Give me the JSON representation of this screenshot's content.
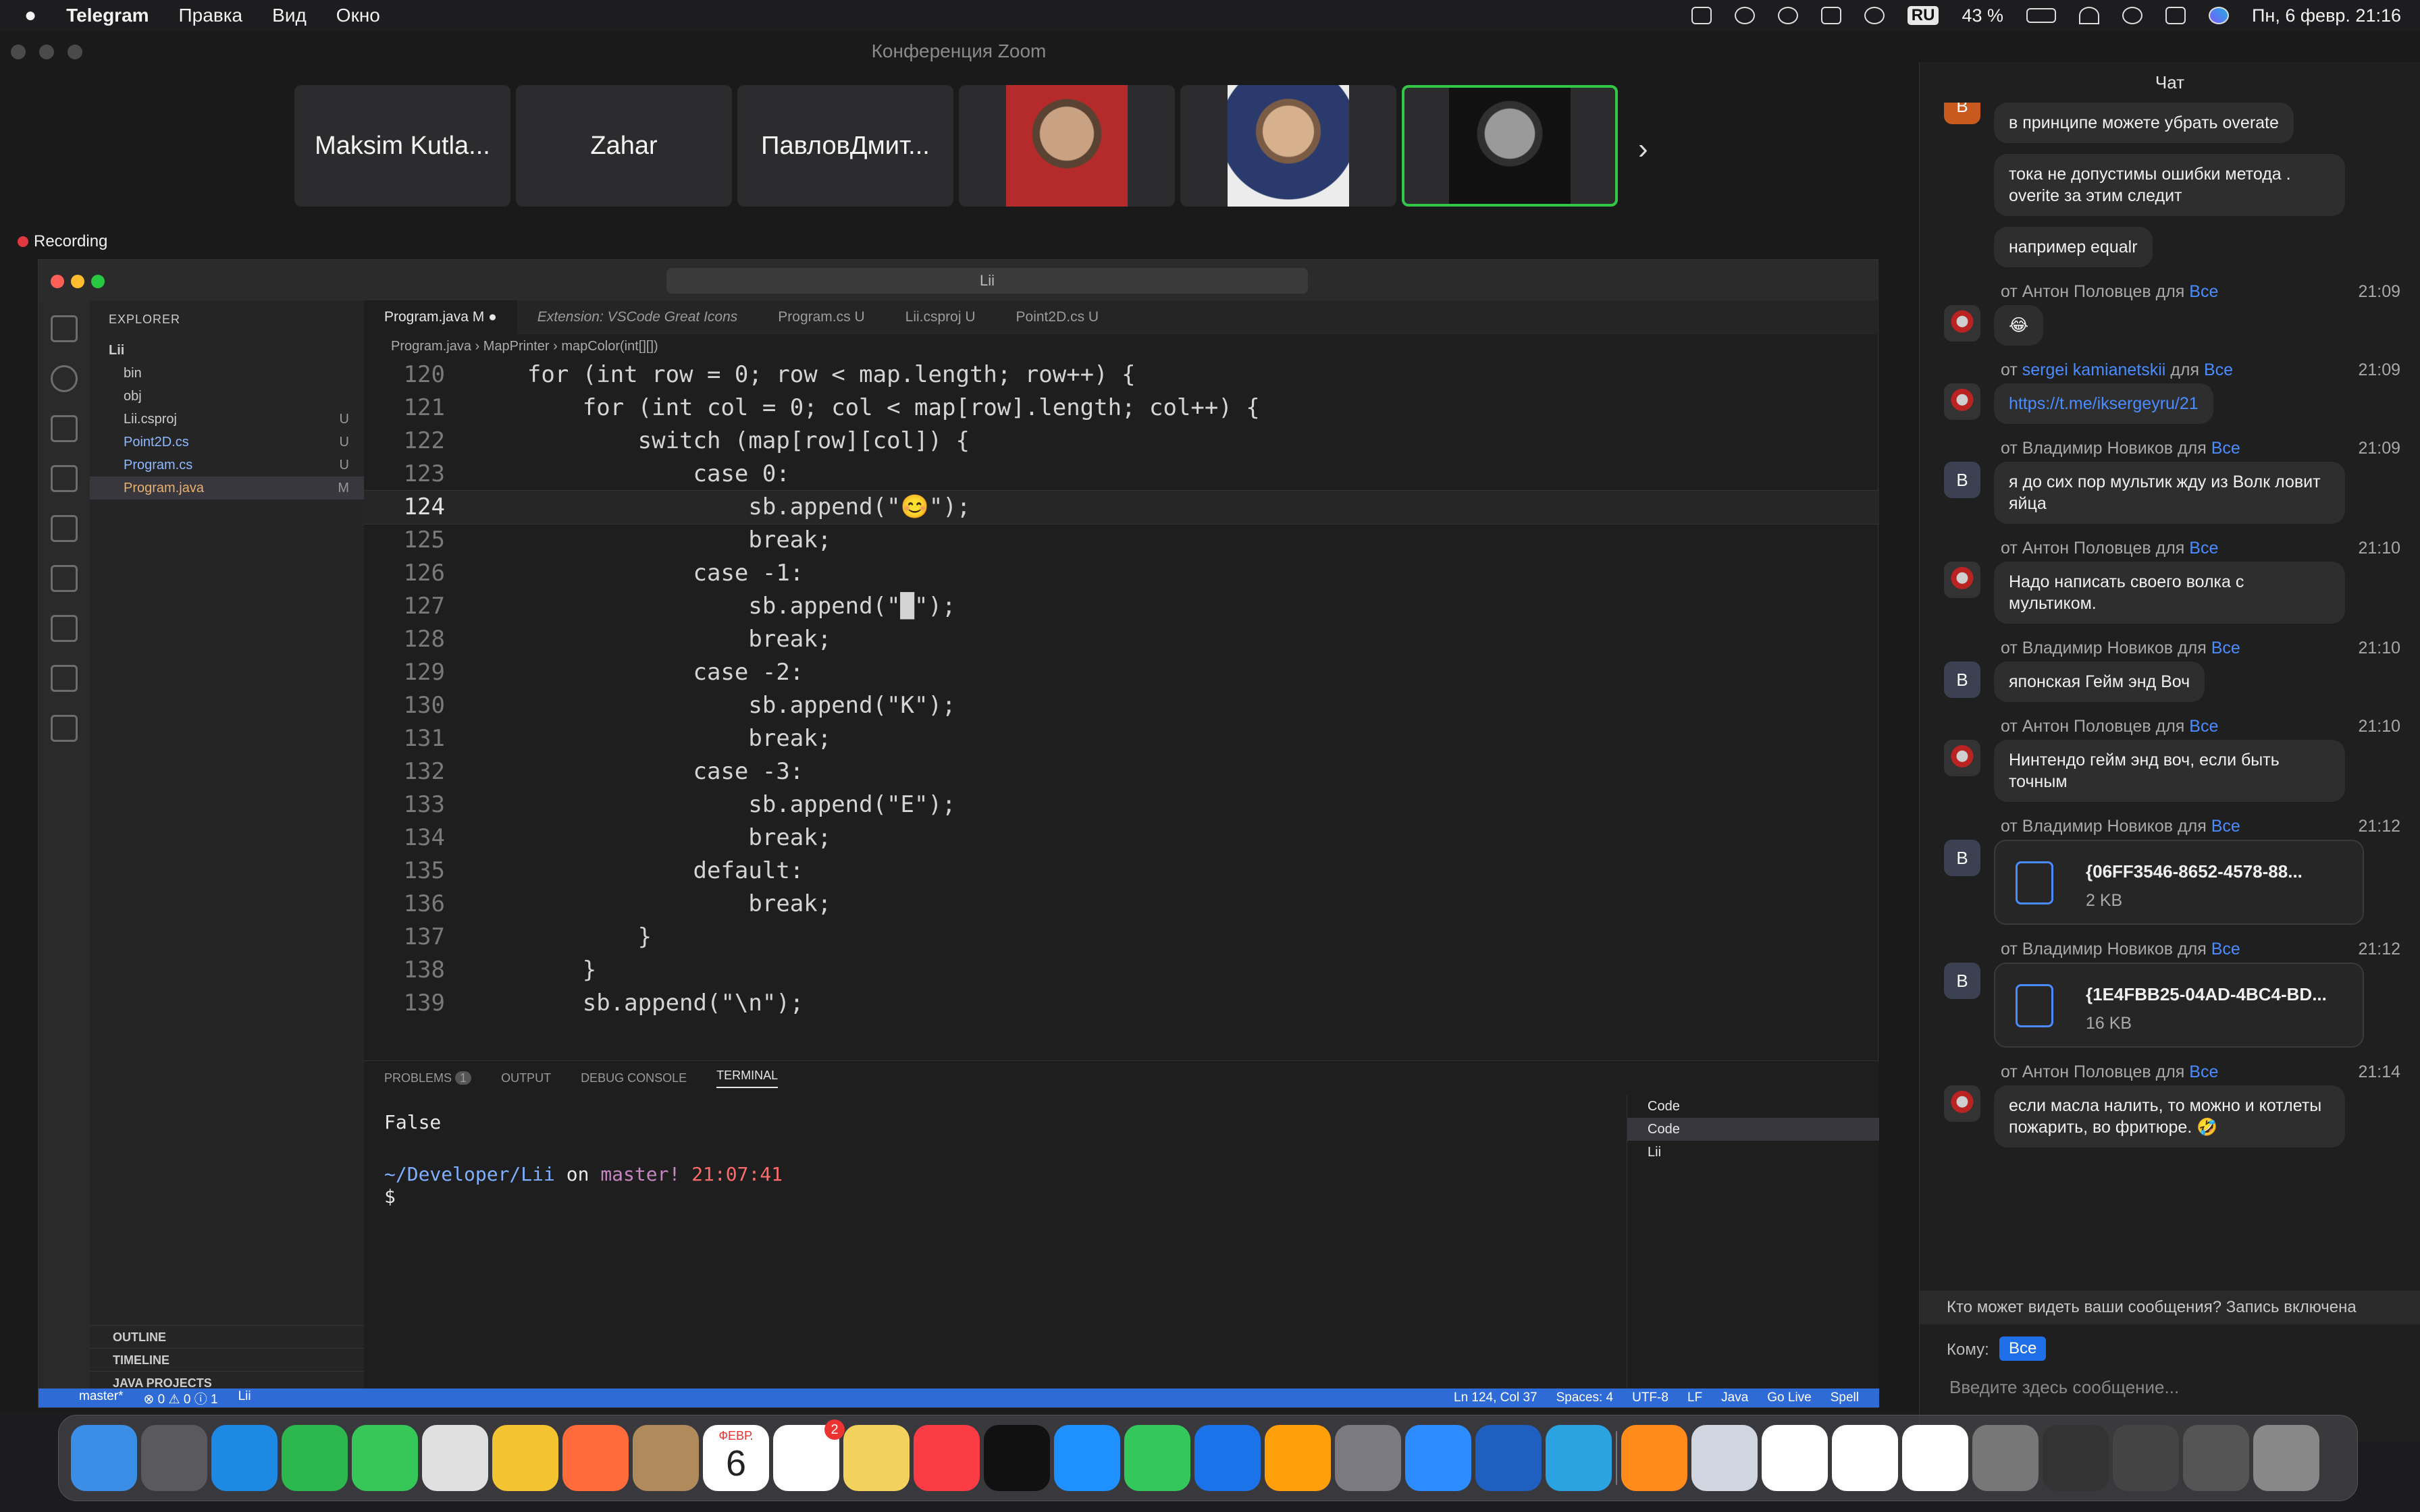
{
  "menubar": {
    "app": "Telegram",
    "items": [
      "Правка",
      "Вид",
      "Окно"
    ],
    "battery": "43 %",
    "input_source": "RU",
    "clock": "Пн, 6 февр. 21:16"
  },
  "zoom": {
    "window_title": "Конференция Zoom",
    "participants": [
      "Maksim Kutla...",
      "Zahar",
      "ПавловДмит..."
    ],
    "recording_label": "Recording"
  },
  "vscode": {
    "search": "Lii",
    "explorer_title": "EXPLORER",
    "tree": {
      "root": "Lii",
      "items": [
        {
          "name": "bin",
          "badge": ""
        },
        {
          "name": "obj",
          "badge": ""
        },
        {
          "name": "Lii.csproj",
          "badge": "U"
        },
        {
          "name": "Point2D.cs",
          "badge": "U"
        },
        {
          "name": "Program.cs",
          "badge": "U"
        },
        {
          "name": "Program.java",
          "badge": "M"
        }
      ]
    },
    "sections": [
      "OUTLINE",
      "TIMELINE",
      "JAVA PROJECTS"
    ],
    "tabs": [
      {
        "label": "Program.java",
        "mark": "M"
      },
      {
        "label": "Extension: VSCode Great Icons",
        "mark": ""
      },
      {
        "label": "Program.cs",
        "mark": "U"
      },
      {
        "label": "Lii.csproj",
        "mark": "U"
      },
      {
        "label": "Point2D.cs",
        "mark": "U"
      }
    ],
    "breadcrumb": [
      "Program.java",
      "MapPrinter",
      "mapColor(int[][])"
    ],
    "code": [
      {
        "n": "120",
        "t": "    for (int row = 0; row < map.length; row++) {"
      },
      {
        "n": "121",
        "t": "        for (int col = 0; col < map[row].length; col++) {"
      },
      {
        "n": "122",
        "t": "            switch (map[row][col]) {"
      },
      {
        "n": "123",
        "t": "                case 0:"
      },
      {
        "n": "124",
        "t": "                    sb.append(\"😊\");"
      },
      {
        "n": "125",
        "t": "                    break;"
      },
      {
        "n": "126",
        "t": "                case -1:"
      },
      {
        "n": "127",
        "t": "                    sb.append(\"█\");"
      },
      {
        "n": "128",
        "t": "                    break;"
      },
      {
        "n": "129",
        "t": "                case -2:"
      },
      {
        "n": "130",
        "t": "                    sb.append(\"K\");"
      },
      {
        "n": "131",
        "t": "                    break;"
      },
      {
        "n": "132",
        "t": "                case -3:"
      },
      {
        "n": "133",
        "t": "                    sb.append(\"E\");"
      },
      {
        "n": "134",
        "t": "                    break;"
      },
      {
        "n": "135",
        "t": "                default:"
      },
      {
        "n": "136",
        "t": "                    break;"
      },
      {
        "n": "137",
        "t": "            }"
      },
      {
        "n": "138",
        "t": "        }"
      },
      {
        "n": "139",
        "t": "        sb.append(\"\\n\");"
      }
    ],
    "panel_tabs": [
      "PROBLEMS",
      "OUTPUT",
      "DEBUG CONSOLE",
      "TERMINAL"
    ],
    "problems_count": "1",
    "terminal": {
      "output": "False",
      "path": "~/Developer/Lii",
      "on": "on",
      "branch": "master!",
      "time": "21:07:41",
      "prompt": "$"
    },
    "terminal_list": [
      "Code",
      "Code",
      "Lii"
    ],
    "status": {
      "branch": "master*",
      "errors": "0",
      "warnings": "0",
      "info": "1",
      "folder": "Lii",
      "position": "Ln 124, Col 37",
      "spaces": "Spaces: 4",
      "encoding": "UTF-8",
      "eol": "LF",
      "lang": "Java",
      "golive": "Go Live",
      "spell": "Spell"
    }
  },
  "chat": {
    "title": "Чат",
    "messages": [
      {
        "kind": "text",
        "avatar": "B",
        "from": "",
        "to": "",
        "time": "",
        "text": "в принципе можете убрать overate"
      },
      {
        "kind": "text",
        "avatar": "",
        "from": "",
        "to": "",
        "time": "",
        "text": "тока не допустимы ошибки метода . overite за этим следит"
      },
      {
        "kind": "text",
        "avatar": "",
        "from": "",
        "to": "",
        "time": "",
        "text": "например equalr"
      },
      {
        "kind": "text",
        "avatar": "photo",
        "from": "от Антон Половцев для",
        "to": "Все",
        "time": "21:09",
        "text": "😂"
      },
      {
        "kind": "link",
        "avatar": "photo2",
        "from": "от",
        "fromlink": "sergei kamianetskii",
        "fromsuffix": "для",
        "to": "Все",
        "time": "21:09",
        "text": "https://t.me/iksergeyru/21"
      },
      {
        "kind": "text",
        "avatar": "B",
        "from": "от Владимир Новиков для",
        "to": "Все",
        "time": "21:09",
        "text": "я до сих пор мультик жду из Волк ловит яйца"
      },
      {
        "kind": "text",
        "avatar": "photo",
        "from": "от Антон Половцев для",
        "to": "Все",
        "time": "21:10",
        "text": "Надо написать своего волка с мультиком."
      },
      {
        "kind": "text",
        "avatar": "B",
        "from": "от Владимир Новиков для",
        "to": "Все",
        "time": "21:10",
        "text": "японская Гейм энд Воч"
      },
      {
        "kind": "text",
        "avatar": "photo",
        "from": "от Антон Половцев для",
        "to": "Все",
        "time": "21:10",
        "text": "Нинтендо гейм энд воч, если быть точным"
      },
      {
        "kind": "file",
        "avatar": "B",
        "from": "от Владимир Новиков для",
        "to": "Все",
        "time": "21:12",
        "name": "{06FF3546-8652-4578-88...",
        "size": "2 KB"
      },
      {
        "kind": "file",
        "avatar": "B",
        "from": "от Владимир Новиков для",
        "to": "Все",
        "time": "21:12",
        "name": "{1E4FBB25-04AD-4BC4-BD...",
        "size": "16 KB"
      },
      {
        "kind": "text",
        "avatar": "photo",
        "from": "от Антон Половцев для",
        "to": "Все",
        "time": "21:14",
        "text": "если масла налить, то можно и котлеты пожарить, во фритюре. 🤣"
      }
    ],
    "privacy": "Кто может видеть ваши сообщения? Запись включена",
    "to_label": "Кому:",
    "to_value": "Все",
    "input_placeholder": "Введите здесь сообщение..."
  },
  "dock": {
    "calendar_month": "ФЕВР.",
    "calendar_day": "6",
    "reminders_badge": "2"
  }
}
